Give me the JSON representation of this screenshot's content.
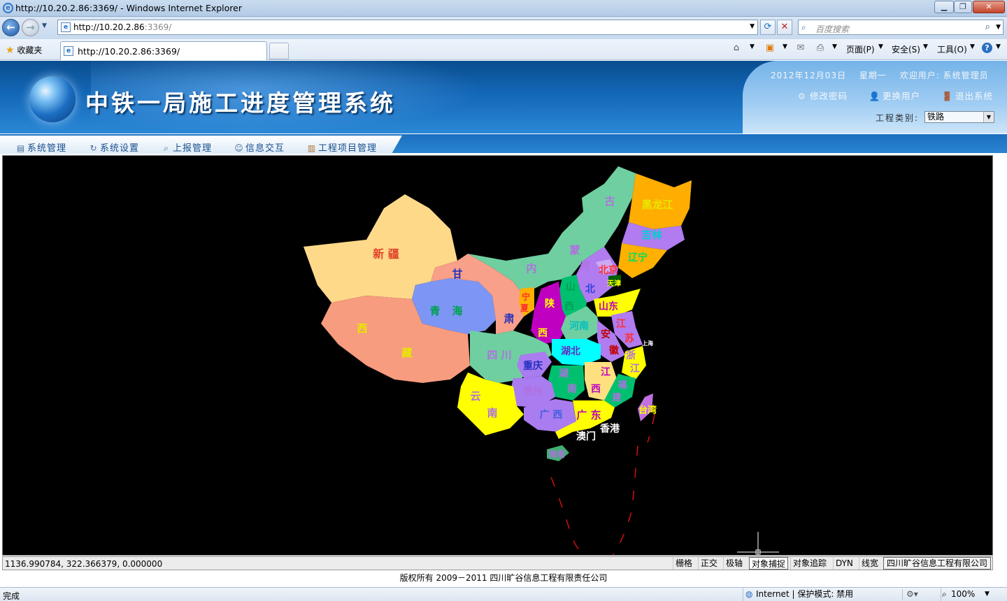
{
  "browser": {
    "window_title": "http://10.20.2.86:3369/ - Windows Internet Explorer",
    "address_host": "http://10.20.2.86",
    "address_port": ":3369/",
    "search_placeholder": "百度搜索",
    "favorites_label": "收藏夹",
    "tab_title": "http://10.20.2.86:3369/",
    "commands": {
      "page": "页面(P)",
      "safety": "安全(S)",
      "tools": "工具(O)"
    },
    "status_text": "完成",
    "zone_text": "Internet | 保护模式: 禁用",
    "zoom_text": "100%"
  },
  "header": {
    "app_title": "中铁一局施工进度管理系统",
    "date": "2012年12月03日",
    "weekday": "星期一",
    "welcome": "欢迎用户: 系统管理员",
    "change_password": "修改密码",
    "switch_user": "更换用户",
    "logout": "退出系统",
    "project_type_label": "工程类别:",
    "project_type_value": "铁路"
  },
  "menu": [
    {
      "label": "系统管理"
    },
    {
      "label": "系统设置"
    },
    {
      "label": "上报管理"
    },
    {
      "label": "信息交互"
    },
    {
      "label": "工程项目管理"
    }
  ],
  "map": {
    "labels": {
      "xinjiang": "新  疆",
      "xizang_1": "西",
      "xizang_2": "藏",
      "qinghai_1": "青",
      "qinghai_2": "海",
      "gansu_1": "甘",
      "gansu_2": "肃",
      "neimenggu_1": "古",
      "neimenggu_2": "蒙",
      "neimenggu_3": "内",
      "heilongjiang": "黑龙江",
      "jilin": "吉林",
      "liaoning": "辽宁",
      "beijing": "北京",
      "tianjin": "天津",
      "hebei_1": "河",
      "hebei_2": "北",
      "shanxi_1": "山",
      "shanxi_2": "西",
      "shaanxi_1": "陕",
      "shaanxi_2": "西",
      "ningxia_1": "宁",
      "ningxia_2": "夏",
      "shandong": "山东",
      "henan": "河南",
      "jiangsu_1": "江",
      "jiangsu_2": "苏",
      "shanghai": "上海",
      "anhui_1": "安",
      "anhui_2": "徽",
      "hubei": "湖北",
      "zhejiang_1": "浙",
      "zhejiang_2": "江",
      "sichuan": "四  川",
      "chongqing": "重庆",
      "hunan_1": "湖",
      "hunan_2": "南",
      "jiangxi_1": "江",
      "jiangxi_2": "西",
      "fujian_1": "福",
      "fujian_2": "建",
      "guizhou": "贵州",
      "yunnan_1": "云",
      "yunnan_2": "南",
      "guangxi": "广 西",
      "guangdong": "广 东",
      "taiwan": "台湾",
      "xianggang": "香港",
      "aomen": "澳门",
      "hainan": "海南"
    },
    "colors": {
      "xinjiang": "#ffd98a",
      "xizang": "#f79c7e",
      "qinghai": "#7d96f5",
      "gansu": "#f8a08a",
      "neimenggu": "#6fcfa0",
      "heilongjiang": "#ffad00",
      "jilin": "#b07cf0",
      "liaoning": "#ffb000",
      "sichuan": "#6fcfa0",
      "yunnan": "#ffff00",
      "guangxi": "#a97cf0",
      "guangdong": "#ffff00",
      "hubei": "#00ffff",
      "shaanxi": "#c000c0",
      "henan": "#6fcfa0",
      "hunan": "#00c070",
      "jiangxi": "#ffe080",
      "fujian": "#00c070",
      "zhejiang": "#ffff00",
      "anhui": "#b07cf0",
      "shandong": "#ffff00",
      "taiwan": "#c070e0",
      "hainan": "#40b070"
    }
  },
  "cad_status": {
    "coords": "1136.990784,  322.366379,  0.000000",
    "toggles": [
      "栅格",
      "正交",
      "极轴",
      "对象捕捉",
      "对象追踪",
      "DYN",
      "线宽"
    ],
    "company": "四川旷谷信息工程有限公司"
  },
  "footer": {
    "copyright": "版权所有 2009－2011 四川旷谷信息工程有限责任公司"
  }
}
